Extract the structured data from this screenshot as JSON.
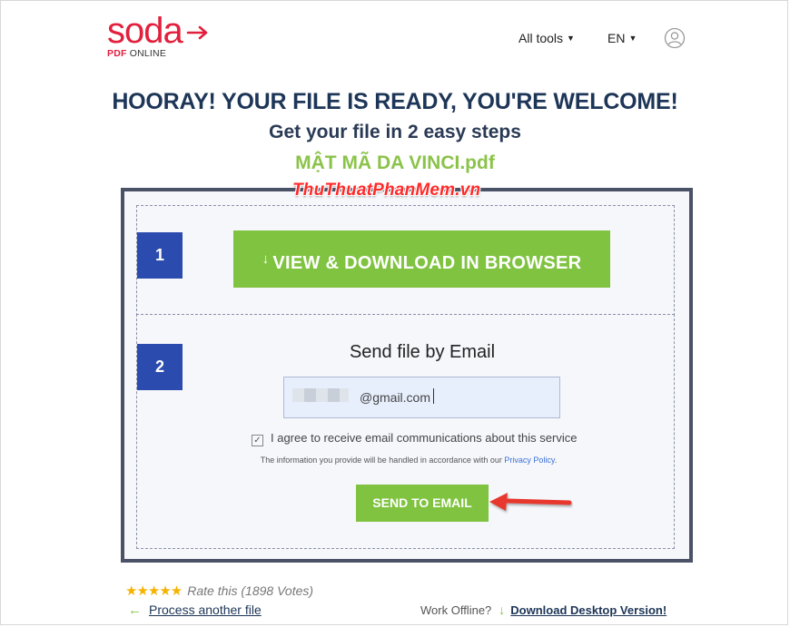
{
  "brand": {
    "logo_word": "soda",
    "logo_sub_red": "PDF",
    "logo_sub_dark": "ONLINE",
    "color_accent": "#e2203d"
  },
  "nav": {
    "all_tools": "All tools",
    "language": "EN",
    "user_icon": "user-circle-icon"
  },
  "hero": {
    "headline": "HOORAY! YOUR FILE IS READY, YOU'RE WELCOME!",
    "subline": "Get your file in 2 easy steps",
    "filename": "MẬT MÃ DA VINCI.pdf"
  },
  "watermark": "ThuThuatPhanMem.vn",
  "step1": {
    "number": "1",
    "button_label": "VIEW & DOWNLOAD IN BROWSER",
    "button_icon": "download-arrow-icon"
  },
  "step2": {
    "number": "2",
    "title": "Send file by Email",
    "email_value": "@gmail.com",
    "agree_label": "I agree to receive email communications about this service",
    "agree_checked": true,
    "legal_text": "The information you provide will be handled in accordance with our ",
    "privacy_link": "Privacy Policy",
    "legal_end": ".",
    "send_label": "SEND TO EMAIL"
  },
  "footer": {
    "stars": "★★★★★",
    "rate_text": "Rate this (1898 Votes)",
    "process_arrow": "←",
    "process_link": "Process another file",
    "offline_text": "Work Offline?",
    "offline_arrow": "↓",
    "desktop_link": "Download Desktop Version!"
  },
  "colors": {
    "green": "#80c341",
    "navy": "#1d3557",
    "step_blue": "#2b4baf",
    "panel_border": "#4a5268",
    "filename_green": "#8bc34a"
  }
}
